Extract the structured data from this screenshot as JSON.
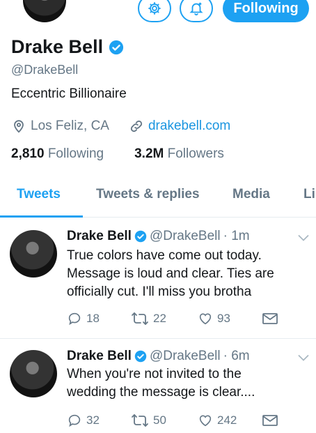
{
  "profile": {
    "name": "Drake Bell",
    "handle": "@DrakeBell",
    "bio": "Eccentric Billionaire",
    "location": "Los Feliz, CA",
    "website": "drakebell.com",
    "following_count": "2,810",
    "following_label": "Following",
    "followers_count": "3.2M",
    "followers_label": "Followers",
    "follow_button": "Following"
  },
  "tabs": [
    {
      "label": "Tweets",
      "active": true
    },
    {
      "label": "Tweets & replies",
      "active": false
    },
    {
      "label": "Media",
      "active": false
    },
    {
      "label": "Li",
      "active": false
    }
  ],
  "tweets": [
    {
      "name": "Drake Bell",
      "handle": "@DrakeBell",
      "time": "· 1m",
      "text": "True colors have come out today. Message is loud and clear. Ties are officially cut. I'll miss you brotha",
      "replies": "18",
      "retweets": "22",
      "likes": "93"
    },
    {
      "name": "Drake Bell",
      "handle": "@DrakeBell",
      "time": "· 6m",
      "text": "When you're not invited to the wedding the message is clear....",
      "replies": "32",
      "retweets": "50",
      "likes": "242"
    }
  ],
  "icons": {
    "settings": "gear-icon",
    "notifications": "bell-plus-icon",
    "verified": "verified-badge-icon",
    "location": "location-pin-icon",
    "website": "link-icon",
    "reply": "reply-icon",
    "retweet": "retweet-icon",
    "like": "heart-icon",
    "dm": "envelope-icon",
    "more": "chevron-down-icon"
  },
  "colors": {
    "accent": "#1da1f2",
    "link": "#1b95e0",
    "secondary_text": "#657786",
    "primary_text": "#14171a"
  }
}
